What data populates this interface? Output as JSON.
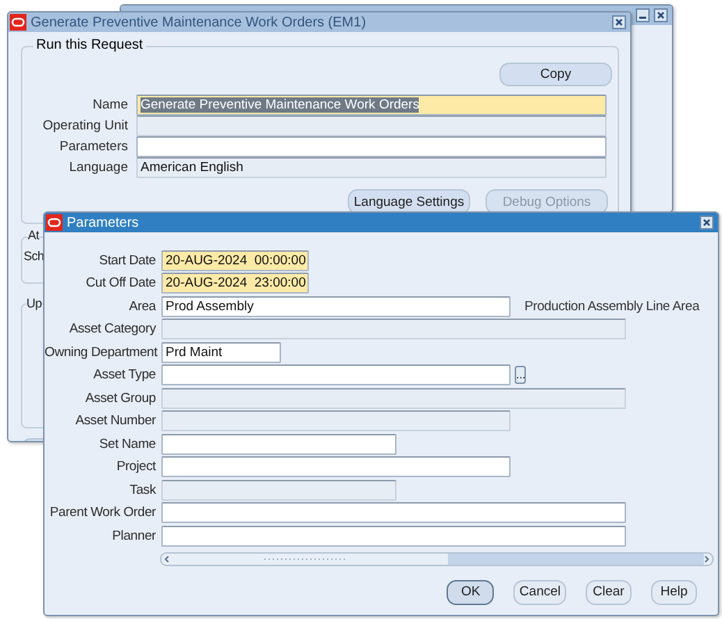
{
  "request_window": {
    "title": "Generate Preventive Maintenance Work Orders (EM1)",
    "active": false,
    "group_title": "Run this Request",
    "copy_button": "Copy",
    "fields": [
      {
        "label": "Name",
        "value": "Generate Preventive Maintenance Work Orders",
        "kind": "required",
        "text_selected": true
      },
      {
        "label": "Operating Unit",
        "kind": "disabled"
      },
      {
        "label": "Parameters",
        "kind": "text"
      },
      {
        "label": "Language",
        "value": "American English",
        "kind": "disabled"
      }
    ],
    "buttons": [
      {
        "label": "Language Settings",
        "disabled": false
      },
      {
        "label": "Debug Options",
        "disabled": true
      }
    ],
    "covered_texts": [
      "At",
      "Sch",
      "Up"
    ]
  },
  "parameters_window": {
    "title": "Parameters",
    "active": true,
    "fields": [
      {
        "label": "Start Date",
        "value": "20-AUG-2024  00:00:00",
        "kind": "required"
      },
      {
        "label": "Cut Off Date",
        "value": "20-AUG-2024  23:00:00",
        "kind": "required"
      },
      {
        "label": "Area",
        "value": "Prod Assembly",
        "kind": "text",
        "description": "Production Assembly Line Area"
      },
      {
        "label": "Asset Category",
        "kind": "disabled"
      },
      {
        "label": "Owning Department",
        "value": "Prd Maint",
        "kind": "text"
      },
      {
        "label": "Asset Type",
        "kind": "text",
        "lov_button": "..."
      },
      {
        "label": "Asset Group",
        "kind": "disabled"
      },
      {
        "label": "Asset Number",
        "kind": "disabled"
      },
      {
        "label": "Set Name",
        "kind": "text"
      },
      {
        "label": "Project",
        "kind": "text"
      },
      {
        "label": "Task",
        "kind": "disabled"
      },
      {
        "label": "Parent Work Order",
        "kind": "text"
      },
      {
        "label": "Planner",
        "kind": "text"
      }
    ],
    "buttons": [
      {
        "label": "OK",
        "default": true
      },
      {
        "label": "Cancel",
        "default": false
      },
      {
        "label": "Clear",
        "default": false
      },
      {
        "label": "Help",
        "default": false
      }
    ]
  }
}
